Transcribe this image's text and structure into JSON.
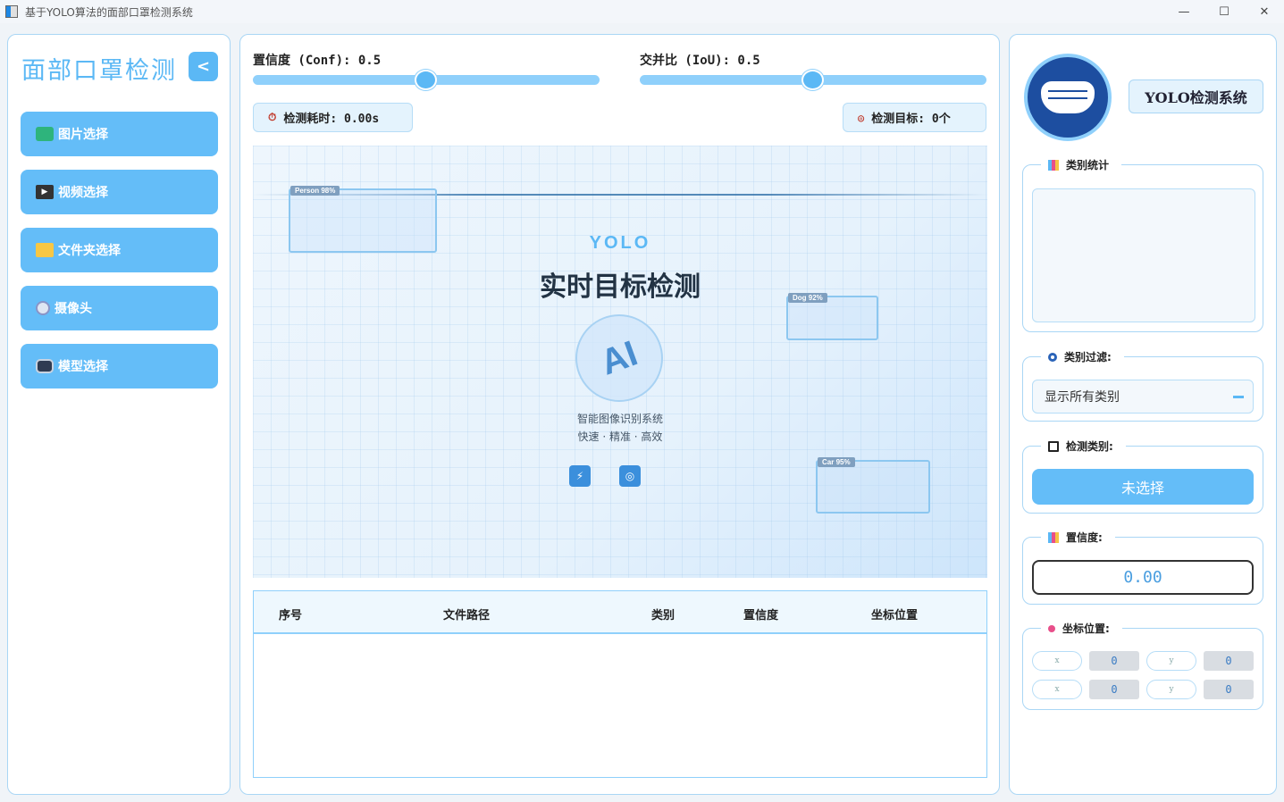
{
  "window": {
    "title": "基于YOLO算法的面部口罩检测系统",
    "minimize": "—",
    "maximize": "☐",
    "close": "✕"
  },
  "sidebar": {
    "title": "面部口罩检测",
    "collapse_icon": "chevron-left-icon",
    "items": [
      {
        "label": "图片选择",
        "icon": "image-icon"
      },
      {
        "label": "视频选择",
        "icon": "clapperboard-icon"
      },
      {
        "label": "文件夹选择",
        "icon": "folder-icon"
      },
      {
        "label": "摄像头",
        "icon": "webcam-icon"
      },
      {
        "label": "模型选择",
        "icon": "robot-icon"
      }
    ]
  },
  "controls": {
    "conf_label": "置信度 (Conf): 0.5",
    "conf_value": 0.5,
    "iou_label": "交并比 (IoU): 0.5",
    "iou_value": 0.5,
    "time_label": "检测耗时: 0.00s",
    "target_label": "检测目标: 0个"
  },
  "preview": {
    "tag": "YOLO",
    "title": "实时目标检测",
    "ai_text": "AI",
    "subtitle1": "智能图像识别系统",
    "subtitle2": "快速 · 精准 · 高效",
    "boxes": [
      {
        "label": "Person 98%"
      },
      {
        "label": "Dog 92%"
      },
      {
        "label": "Car 95%"
      }
    ]
  },
  "table": {
    "headers": [
      "序号",
      "文件路径",
      "类别",
      "置信度",
      "坐标位置"
    ],
    "rows": []
  },
  "right": {
    "system_name": "YOLO检测系统",
    "stats_title": "类别统计",
    "filter_title": "类别过滤:",
    "filter_value": "显示所有类别",
    "detect_title": "检测类别:",
    "detect_value": "未选择",
    "conf_title": "置信度:",
    "conf_value": "0.00",
    "coord_title": "坐标位置:",
    "coords": [
      {
        "label": "x",
        "value": "0"
      },
      {
        "label": "y",
        "value": "0"
      },
      {
        "label": "x",
        "value": "0"
      },
      {
        "label": "y",
        "value": "0"
      }
    ]
  },
  "colors": {
    "accent": "#64bdf8",
    "track": "#8fd0fb",
    "border": "#a9d6f5",
    "brand_dark": "#1d4ea0"
  }
}
